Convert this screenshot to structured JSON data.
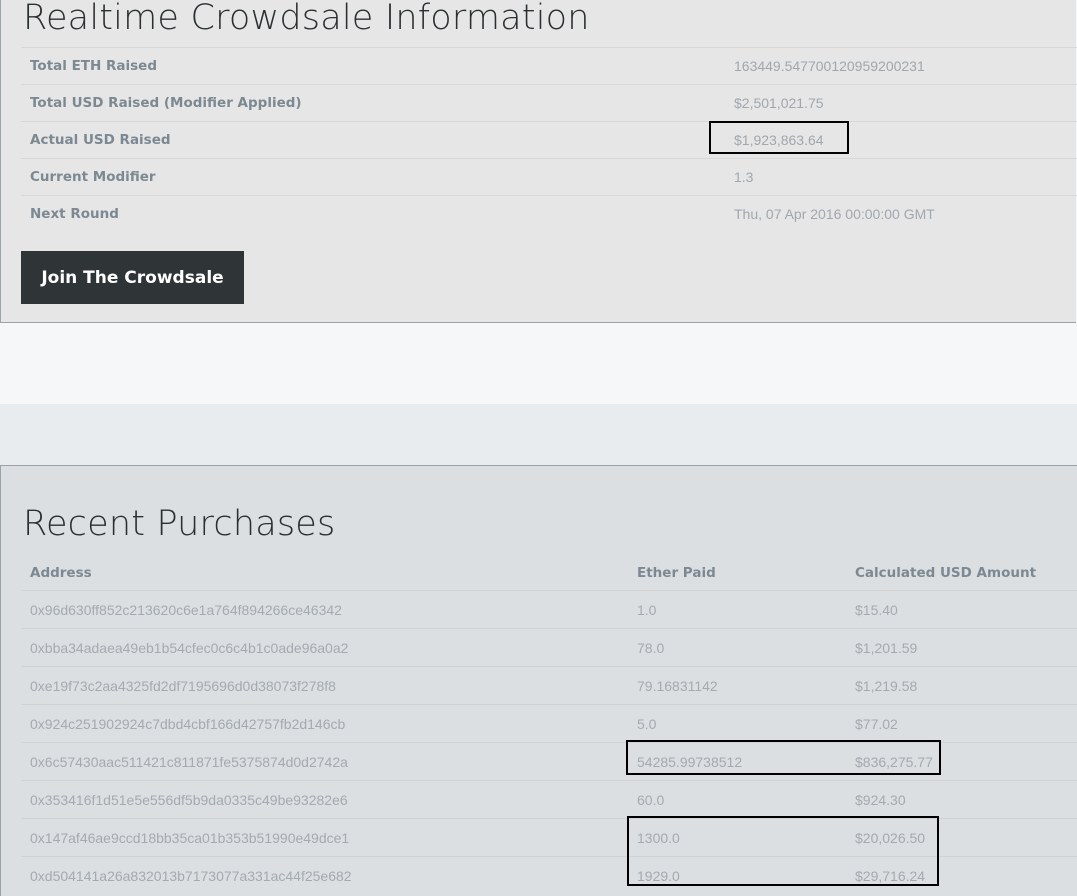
{
  "crowdsale": {
    "title": "Realtime Crowdsale Information",
    "rows": [
      {
        "label": "Total ETH Raised",
        "value": "163449.547700120959200231"
      },
      {
        "label": "Total USD Raised (Modifier Applied)",
        "value": "$2,501,021.75"
      },
      {
        "label": "Actual USD Raised",
        "value": "$1,923,863.64"
      },
      {
        "label": "Current Modifier",
        "value": "1.3"
      },
      {
        "label": "Next Round",
        "value": "Thu, 07 Apr 2016 00:00:00 GMT"
      }
    ],
    "join_button": "Join The Crowdsale"
  },
  "purchases": {
    "title": "Recent Purchases",
    "headers": {
      "address": "Address",
      "ether": "Ether Paid",
      "usd": "Calculated USD Amount"
    },
    "rows": [
      {
        "address": "0x96d630ff852c213620c6e1a764f894266ce46342",
        "ether": "1.0",
        "usd": "$15.40"
      },
      {
        "address": "0xbba34adaea49eb1b54cfec0c6c4b1c0ade96a0a2",
        "ether": "78.0",
        "usd": "$1,201.59"
      },
      {
        "address": "0xe19f73c2aa4325fd2df7195696d0d38073f278f8",
        "ether": "79.16831142",
        "usd": "$1,219.58"
      },
      {
        "address": "0x924c251902924c7dbd4cbf166d42757fb2d146cb",
        "ether": "5.0",
        "usd": "$77.02"
      },
      {
        "address": "0x6c57430aac511421c811871fe5375874d0d2742a",
        "ether": "54285.99738512",
        "usd": "$836,275.77"
      },
      {
        "address": "0x353416f1d51e5e556df5b9da0335c49be93282e6",
        "ether": "60.0",
        "usd": "$924.30"
      },
      {
        "address": "0x147af46ae9ccd18bb35ca01b353b51990e49dce1",
        "ether": "1300.0",
        "usd": "$20,026.50"
      },
      {
        "address": "0xd504141a26a832013b7173077a331ac44f25e682",
        "ether": "1929.0",
        "usd": "$29,716.24"
      }
    ]
  }
}
